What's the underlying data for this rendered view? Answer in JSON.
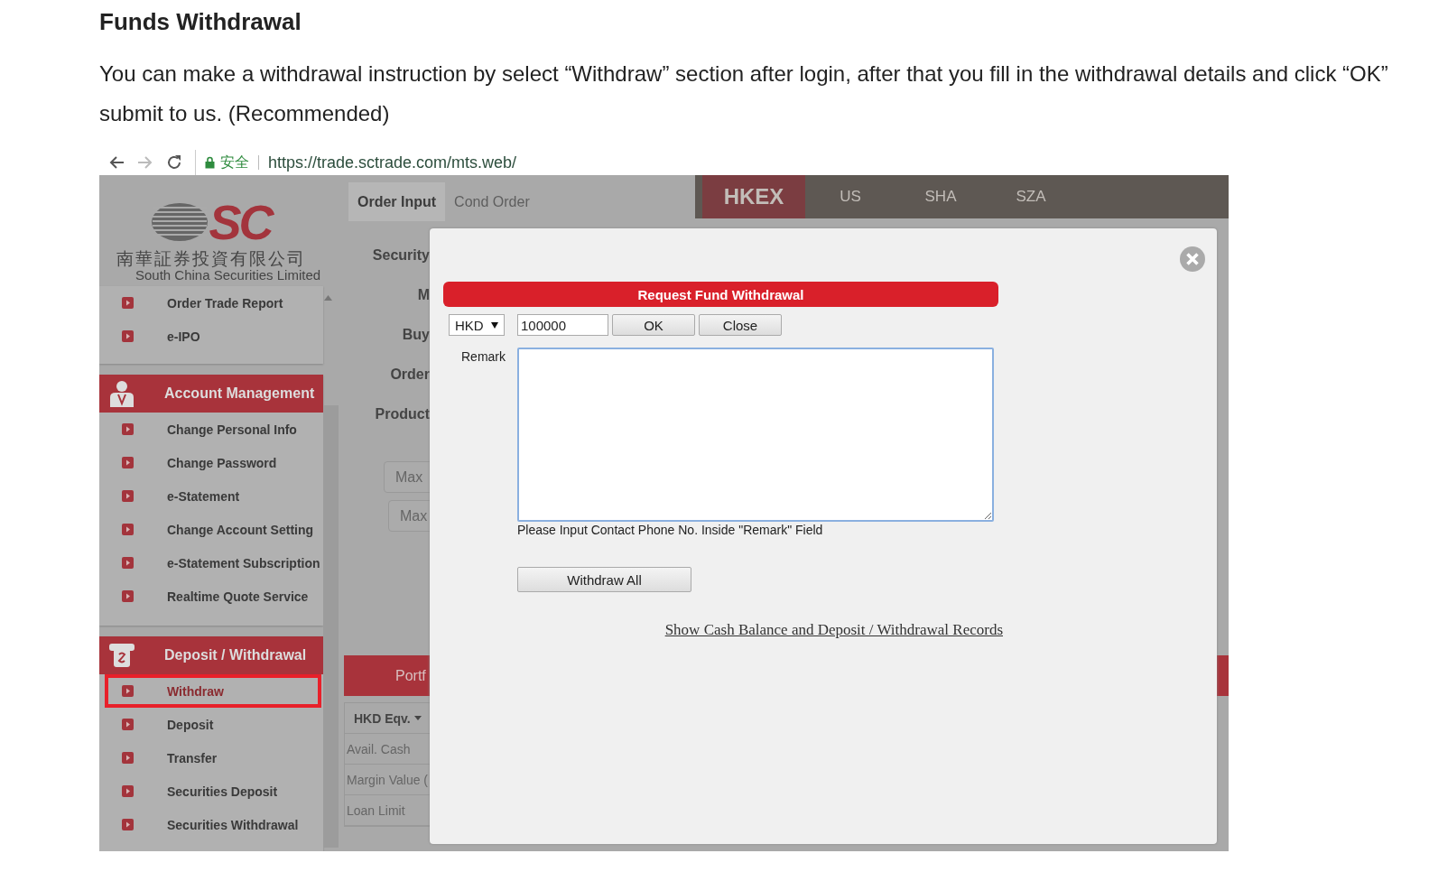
{
  "heading": "Funds Withdrawal",
  "paragraph": "You can make a withdrawal instruction by select “Withdraw” section after login, after that you fill in the withdrawal details and click “OK” submit to us. (Recommended)",
  "browser": {
    "security_label": "安全",
    "url": "https://trade.sctrade.com/mts.web/"
  },
  "logo": {
    "mark": "SC",
    "name_chinese": "南華証券投資有限公司",
    "name_english": "South China Securities Limited"
  },
  "sidebar": {
    "groups": [
      {
        "kind": "plain",
        "items": [
          {
            "label": "Order Trade Report",
            "selected": false
          },
          {
            "label": "e-IPO",
            "selected": false
          }
        ]
      },
      {
        "kind": "account",
        "title": "Account Management",
        "items": [
          {
            "label": "Change Personal Info",
            "selected": false
          },
          {
            "label": "Change Password",
            "selected": false
          },
          {
            "label": "e-Statement",
            "selected": false
          },
          {
            "label": "Change Account Setting",
            "selected": false
          },
          {
            "label": "e-Statement Subscription",
            "selected": false
          },
          {
            "label": "Realtime Quote Service",
            "selected": false
          }
        ]
      },
      {
        "kind": "money",
        "title": "Deposit / Withdrawal",
        "items": [
          {
            "label": "Withdraw",
            "selected": true
          },
          {
            "label": "Deposit",
            "selected": false
          },
          {
            "label": "Transfer",
            "selected": false
          },
          {
            "label": "Securities Deposit",
            "selected": false
          },
          {
            "label": "Securities Withdrawal",
            "selected": false
          }
        ]
      }
    ]
  },
  "order_tabs": [
    {
      "label": "Order Input",
      "selected": true
    },
    {
      "label": "Cond Order",
      "selected": false
    }
  ],
  "market_tabs": [
    {
      "label": "HKEX",
      "selected": true
    },
    {
      "label": "US",
      "selected": false
    },
    {
      "label": "SHA",
      "selected": false
    },
    {
      "label": "SZA",
      "selected": false
    }
  ],
  "order_form": {
    "labels": [
      "Security",
      "M",
      "Buy",
      "Order",
      "Product"
    ],
    "max_buttons": [
      "Max",
      "Max"
    ]
  },
  "portfolio": {
    "title": "Portf",
    "currency": "HKD Eqv.",
    "rows": [
      "Avail. Cash",
      "Margin Value (",
      "Loan Limit"
    ]
  },
  "dialog": {
    "title": "Request Fund Withdrawal",
    "currency": "HKD",
    "amount": "100000",
    "ok": "OK",
    "close": "Close",
    "remark_label": "Remark",
    "hint": "Please Input Contact Phone No. Inside \"Remark\" Field",
    "withdraw_all": "Withdraw All",
    "records_link": "Show Cash Balance and Deposit / Withdrawal Records"
  }
}
